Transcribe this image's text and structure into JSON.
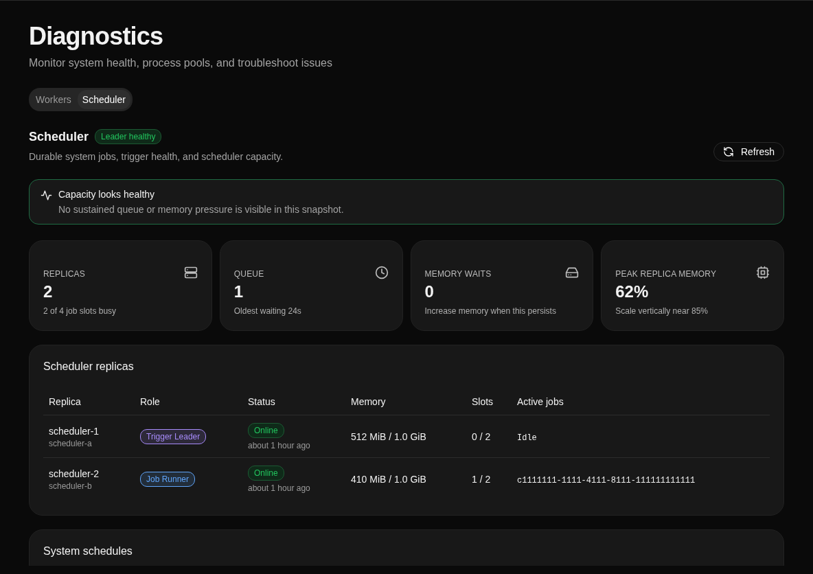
{
  "page": {
    "title": "Diagnostics",
    "subtitle": "Monitor system health, process pools, and troubleshoot issues"
  },
  "tabs": [
    {
      "label": "Workers",
      "selected": false
    },
    {
      "label": "Scheduler",
      "selected": true
    }
  ],
  "section": {
    "title": "Scheduler",
    "badge": "Leader healthy",
    "description": "Durable system jobs, trigger health, and scheduler capacity.",
    "refresh_button": "Refresh"
  },
  "alert": {
    "title": "Capacity looks healthy",
    "message": "No sustained queue or memory pressure is visible in this snapshot."
  },
  "stats": [
    {
      "label": "REPLICAS",
      "value": "2",
      "note": "2 of 4 job slots busy",
      "kind": "server"
    },
    {
      "label": "QUEUE",
      "value": "1",
      "note": "Oldest waiting 24s",
      "kind": "clock"
    },
    {
      "label": "MEMORY WAITS",
      "value": "0",
      "note": "Increase memory when this persists",
      "kind": "drive"
    },
    {
      "label": "PEAK REPLICA MEMORY",
      "value": "62%",
      "note": "Scale vertically near 85%",
      "kind": "chip"
    }
  ],
  "replicas": {
    "title": "Scheduler replicas",
    "columns": [
      "Replica",
      "Role",
      "Status",
      "Memory",
      "Slots",
      "Active jobs"
    ],
    "rows": [
      {
        "name": "scheduler-1",
        "host": "scheduler-a",
        "role": {
          "label": "Trigger Leader",
          "color": "#a78bfa"
        },
        "status": "Online",
        "seen": "about 1 hour ago",
        "memory": "512 MiB / 1.0 GiB",
        "slots": "0 / 2",
        "active_jobs": "Idle"
      },
      {
        "name": "scheduler-2",
        "host": "scheduler-b",
        "role": {
          "label": "Job Runner",
          "color": "#60a5fa"
        },
        "status": "Online",
        "seen": "about 1 hour ago",
        "memory": "410 MiB / 1.0 GiB",
        "slots": "1 / 2",
        "active_jobs": "c1111111-1111-4111-8111-111111111111"
      }
    ]
  },
  "schedules": {
    "title": "System schedules"
  }
}
